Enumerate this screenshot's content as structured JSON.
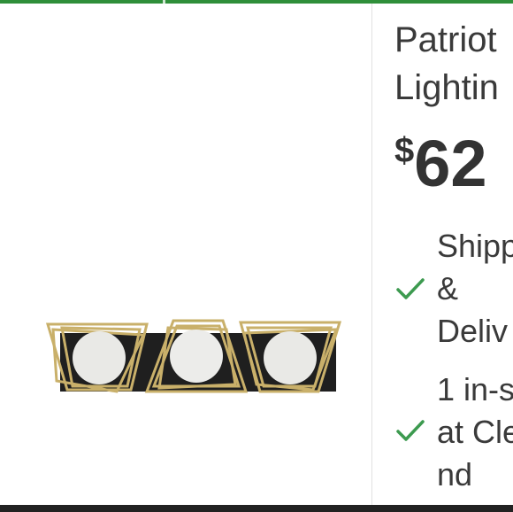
{
  "product": {
    "title_line1": "Patriot",
    "title_line2": "Lightin",
    "price_currency": "$",
    "price_amount": "62",
    "image_alt": "Three-light vanity fixture with gold geometric frames and white globe shades"
  },
  "fulfillment": {
    "shipping": {
      "line1": "Shipp",
      "line2": "&",
      "line3": "Deliv"
    },
    "store": {
      "line1": "1 in-s",
      "line2": "at Cle",
      "line3": "nd"
    }
  },
  "colors": {
    "accent_green": "#2f8f3a",
    "check_green": "#3c9a4f",
    "text": "#3a3a3a"
  },
  "icons": [
    "checkmark-icon",
    "checkmark-icon"
  ]
}
